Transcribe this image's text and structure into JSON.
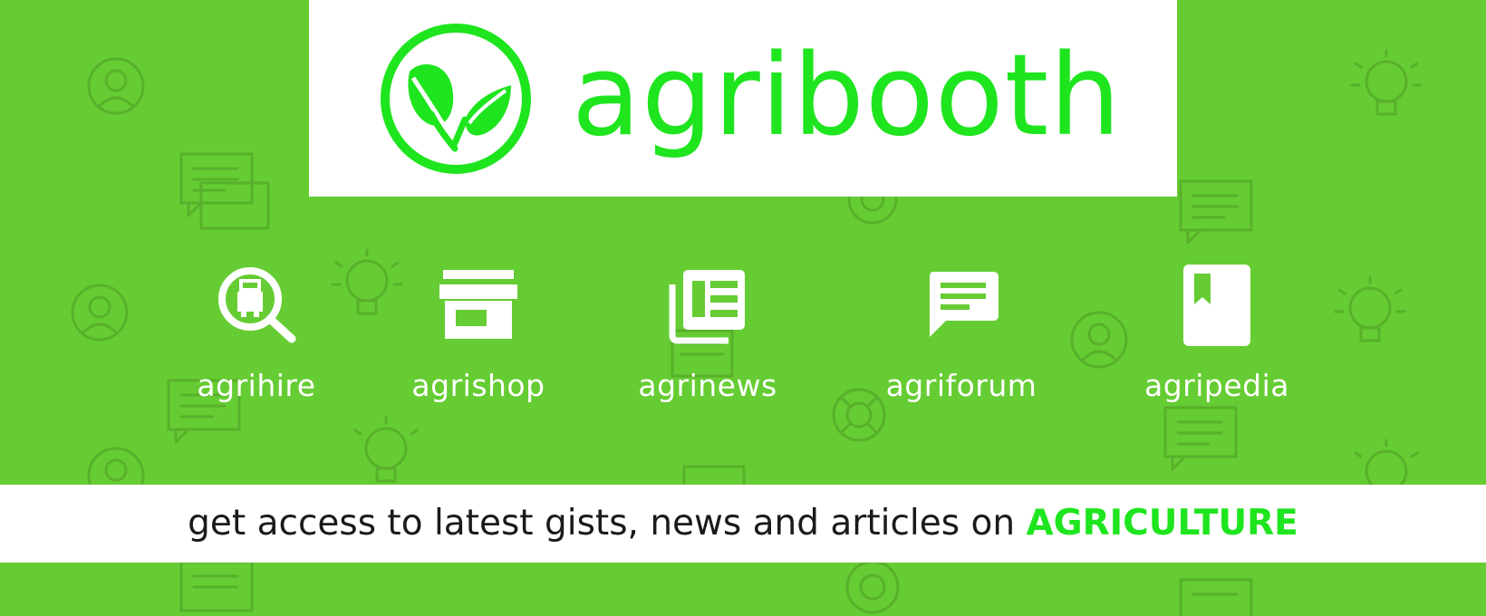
{
  "colors": {
    "background": "#66cc33",
    "brand_green": "#1ee51e",
    "pattern": "#58b02b",
    "text_dark": "#1a1a1a",
    "white": "#ffffff"
  },
  "header": {
    "brand_name": "agribooth",
    "logo_icon": "leaf-circle-logo-icon"
  },
  "nav": {
    "items": [
      {
        "label": "agrihire",
        "icon": "truck-search-icon"
      },
      {
        "label": "agrishop",
        "icon": "storefront-icon"
      },
      {
        "label": "agrinews",
        "icon": "newspaper-icon"
      },
      {
        "label": "agriforum",
        "icon": "chat-bubble-icon"
      },
      {
        "label": "agripedia",
        "icon": "bookmark-book-icon"
      }
    ]
  },
  "tagline": {
    "text": "get access to latest gists, news and articles on ",
    "highlight": "AGRICULTURE"
  }
}
